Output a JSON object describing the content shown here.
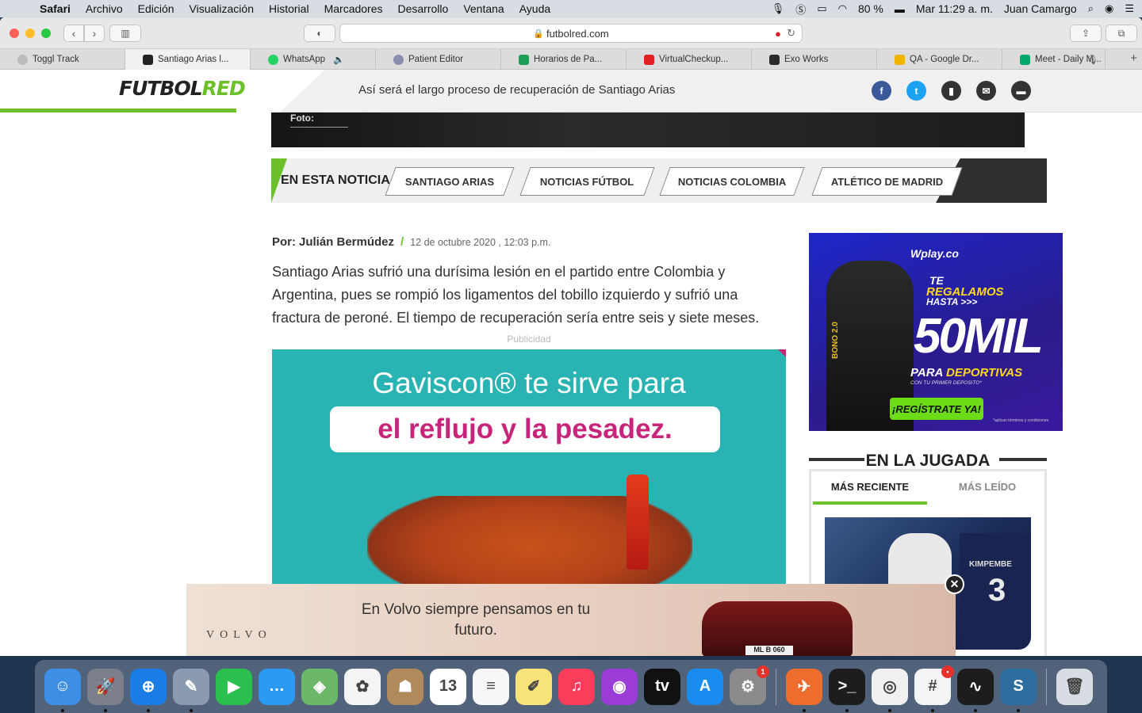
{
  "menubar": {
    "apple": "",
    "app": "Safari",
    "items": [
      "Archivo",
      "Edición",
      "Visualización",
      "Historial",
      "Marcadores",
      "Desarrollo",
      "Ventana",
      "Ayuda"
    ],
    "battery": "80 %",
    "clock": "Mar 11:29 a. m.",
    "user": "Juan Camargo"
  },
  "browser": {
    "url": "futbolred.com",
    "tabs": [
      {
        "label": "Toggl Track",
        "icon_color": "#888888"
      },
      {
        "label": "Santiago Arias l...",
        "icon_color": "#222222"
      },
      {
        "label": "WhatsApp",
        "icon_color": "#25d366"
      },
      {
        "label": "Patient Editor",
        "icon_color": "#8a8fb0"
      },
      {
        "label": "Horarios de Pa...",
        "icon_color": "#1e9d57"
      },
      {
        "label": "VirtualCheckup...",
        "icon_color": "#e02020"
      },
      {
        "label": "Exo Works",
        "icon_color": "#2a2a2a"
      },
      {
        "label": "QA - Google Dr...",
        "icon_color": "#f2b300"
      },
      {
        "label": "Meet - Daily M...",
        "icon_color": "#00a86b"
      }
    ]
  },
  "site": {
    "logo_part1": "FUTBOL",
    "logo_part2": "RED",
    "header_title": "Así será el largo proceso de recuperación de Santiago Arias",
    "photo_caption": "Foto:",
    "tags_label": "EN ESTA NOTICIA",
    "tags": [
      "SANTIAGO ARIAS",
      "NOTICIAS FÚTBOL",
      "NOTICIAS COLOMBIA",
      "ATLÉTICO DE MADRID"
    ],
    "byline_prefix": "Por:",
    "author": "Julián Bermúdez",
    "date": "12 de octubre 2020 , 12:03 p.m.",
    "lead": "Santiago Arias sufrió una durísima lesión en el partido entre Colombia y Argentina, pues se rompió los ligamentos del tobillo izquierdo y sufrió una fractura de peroné. El tiempo de recuperación sería entre seis y siete meses.",
    "publicidad": "Publicidad"
  },
  "ads": {
    "gaviscon_line1": "Gaviscon® te sirve para",
    "gaviscon_line2": "el reflujo y la pesadez.",
    "wplay_brand": "Wplay.co",
    "wplay_line1": "TE",
    "wplay_line2": "REGALAMOS",
    "wplay_line3": "HASTA >>>",
    "wplay_big": "50MIL",
    "wplay_para_prefix": "PARA",
    "wplay_para_word": "DEPORTIVAS",
    "wplay_sub": "CON TU PRIMER DEPOSITO*",
    "wplay_cta": "¡REGÍSTRATE YA!",
    "wplay_bono": "BONO 2.0",
    "wplay_fine": "*aplican términos y condiciones",
    "volvo_brand": "VOLVO",
    "volvo_text": "En Volvo siempre pensamos en tu futuro.",
    "volvo_plate": "ML B 060"
  },
  "sidebar": {
    "section_title": "EN LA JUGADA",
    "tab_recent": "MÁS RECIENTE",
    "tab_read": "MÁS LEÍDO",
    "image_player_name": "KIMPEMBE",
    "image_player_number": "3"
  },
  "dock": {
    "apps": [
      {
        "name": "finder",
        "color": "#3d8fe6",
        "glyph": "☺",
        "running": true
      },
      {
        "name": "launchpad",
        "color": "#7a7f8a",
        "glyph": "🚀",
        "running": true
      },
      {
        "name": "safari",
        "color": "#1a7de6",
        "glyph": "⊕",
        "running": true
      },
      {
        "name": "preview",
        "color": "#8a9ab0",
        "glyph": "✎",
        "running": true
      },
      {
        "name": "facetime",
        "color": "#2bc04e",
        "glyph": "▶",
        "running": false
      },
      {
        "name": "messages",
        "color": "#2b9af3",
        "glyph": "…",
        "running": false
      },
      {
        "name": "maps",
        "color": "#6bb86b",
        "glyph": "◈",
        "running": false
      },
      {
        "name": "photos",
        "color": "#f4f4f4",
        "glyph": "✿",
        "running": false
      },
      {
        "name": "contacts",
        "color": "#b08a5a",
        "glyph": "☗",
        "running": false
      },
      {
        "name": "calendar",
        "color": "#ffffff",
        "glyph": "13",
        "running": false
      },
      {
        "name": "reminders",
        "color": "#f7f7f7",
        "glyph": "≡",
        "running": false
      },
      {
        "name": "notes",
        "color": "#f8e27a",
        "glyph": "✐",
        "running": false
      },
      {
        "name": "music",
        "color": "#fb3d5c",
        "glyph": "♫",
        "running": false
      },
      {
        "name": "podcasts",
        "color": "#9b3cd6",
        "glyph": "◉",
        "running": false
      },
      {
        "name": "apple-tv",
        "color": "#111111",
        "glyph": "tv",
        "running": false
      },
      {
        "name": "app-store",
        "color": "#1a8cf0",
        "glyph": "A",
        "running": false
      },
      {
        "name": "system-preferences",
        "color": "#8a8a8a",
        "glyph": "⚙",
        "running": false,
        "badge": "1"
      },
      {
        "name": "postman",
        "color": "#ef6c2f",
        "glyph": "✈",
        "running": true,
        "separator_before": true
      },
      {
        "name": "terminal",
        "color": "#1d1d1d",
        "glyph": ">_",
        "running": true
      },
      {
        "name": "chrome",
        "color": "#f0f0f0",
        "glyph": "◎",
        "running": true
      },
      {
        "name": "slack",
        "color": "#f4f4f4",
        "glyph": "#",
        "running": true,
        "badge": "•"
      },
      {
        "name": "activity-monitor",
        "color": "#1d1d1d",
        "glyph": "∿",
        "running": true
      },
      {
        "name": "shield-app",
        "color": "#2e6e9e",
        "glyph": "S",
        "running": true
      },
      {
        "name": "trash",
        "color": "#d8dde3",
        "glyph": "🗑",
        "running": false,
        "separator_before": true
      }
    ]
  }
}
